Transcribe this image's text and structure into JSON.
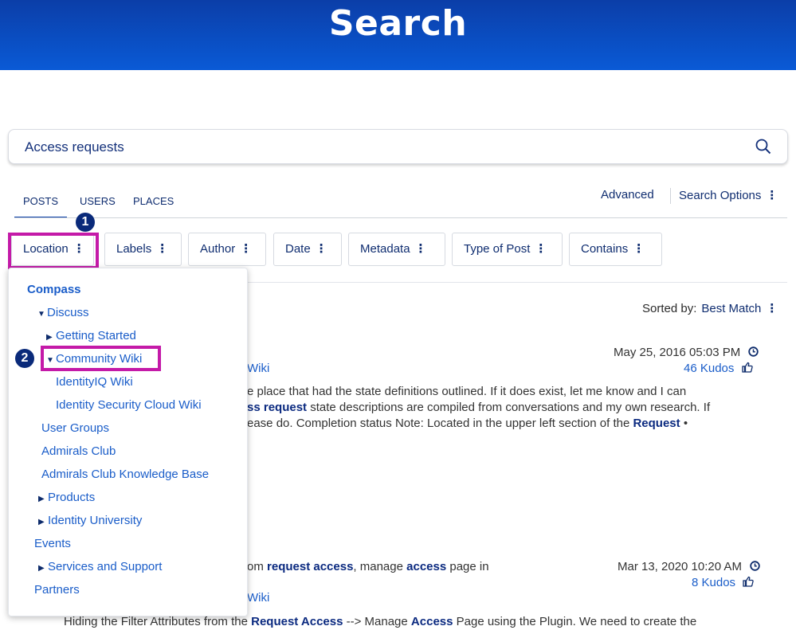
{
  "header": {
    "title": "Search"
  },
  "search": {
    "value": "Access requests"
  },
  "tabs": [
    {
      "label": "POSTS"
    },
    {
      "label": "USERS"
    },
    {
      "label": "PLACES"
    }
  ],
  "toolbar": {
    "advanced": "Advanced",
    "search_options": "Search Options"
  },
  "filters": [
    {
      "label": "Location"
    },
    {
      "label": "Labels"
    },
    {
      "label": "Author"
    },
    {
      "label": "Date"
    },
    {
      "label": "Metadata"
    },
    {
      "label": "Type of Post"
    },
    {
      "label": "Contains"
    }
  ],
  "callouts": {
    "one": "1",
    "two": "2"
  },
  "sort": {
    "label": "Sorted by:",
    "value": "Best Match"
  },
  "location_tree": [
    {
      "label": "Compass"
    },
    {
      "label": "Discuss"
    },
    {
      "label": "Getting Started"
    },
    {
      "label": "Community Wiki"
    },
    {
      "label": "IdentityIQ Wiki"
    },
    {
      "label": "Identity Security Cloud Wiki"
    },
    {
      "label": "User Groups"
    },
    {
      "label": "Admirals Club"
    },
    {
      "label": "Admirals Club Knowledge Base"
    },
    {
      "label": "Products"
    },
    {
      "label": "Identity University"
    },
    {
      "label": "Events"
    },
    {
      "label": "Services and Support"
    },
    {
      "label": "Partners"
    }
  ],
  "results": [
    {
      "date": "May 25, 2016 05:03 PM",
      "kudos": "46 Kudos",
      "location_fragment": "Wiki",
      "line1": "e place that had the state definitions outlined. If it does exist, let me know and I can",
      "line2_bold": "ss request",
      "line2_rest": " state descriptions are compiled from conversations and my own research. If",
      "line3_pre": "ease do.   Completion status Note: Located in the upper left section of the ",
      "line3_bold": "Request",
      "line3_post": " •"
    },
    {
      "date": "Mar 13, 2020 10:20 AM",
      "kudos": "8 Kudos",
      "location_fragment": "Wiki",
      "title_pre": "om ",
      "title_b1": "request access",
      "title_mid": ", manage ",
      "title_b2": "access",
      "title_post": " page in",
      "snip_pre": "Hiding the Filter Attributes from the ",
      "snip_b1": "Request Access",
      "snip_mid": " --> Manage ",
      "snip_b2": "Access",
      "snip_post": " Page using the Plugin. We need to create the"
    }
  ]
}
